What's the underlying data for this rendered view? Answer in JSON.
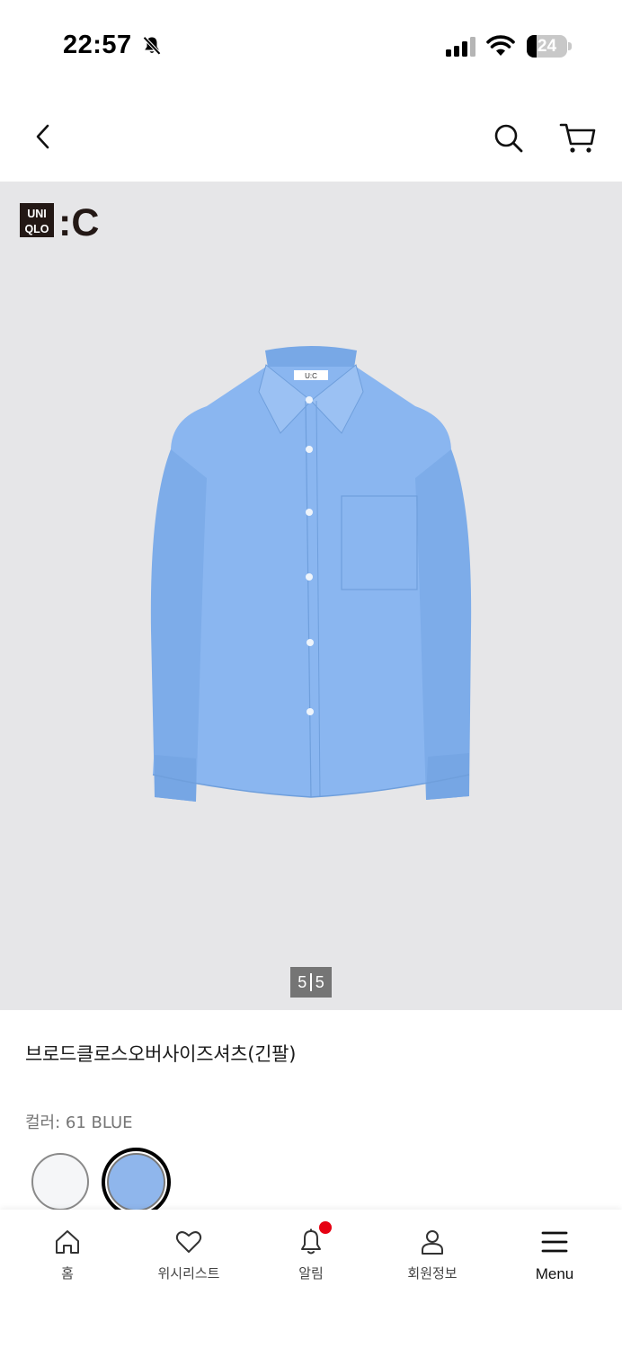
{
  "status_bar": {
    "time": "22:57",
    "battery": "24",
    "battery_level": 0.24,
    "icons": [
      "bell-slash-icon",
      "cellular-signal-icon",
      "wifi-icon",
      "battery-icon"
    ]
  },
  "top_nav": {
    "icons": [
      "chevron-left-icon",
      "search-icon",
      "cart-icon"
    ]
  },
  "gallery": {
    "brand_top": "UNI",
    "brand_bottom": "QLO",
    "brand_suffix": ":C",
    "collar_tag": "U:C",
    "page_current": "5",
    "page_total": "5"
  },
  "product": {
    "title": "브로드클로스오버사이즈셔츠(긴팔)",
    "color_label": "컬러: 61 BLUE",
    "swatches": [
      {
        "name": "white",
        "color": "#f5f6f8",
        "selected": false
      },
      {
        "name": "blue",
        "color": "#8fb6ec",
        "selected": true
      }
    ]
  },
  "tab_bar": {
    "tabs": [
      {
        "label": "홈",
        "icon": "home-icon"
      },
      {
        "label": "위시리스트",
        "icon": "heart-icon"
      },
      {
        "label": "알림",
        "icon": "bell-icon",
        "badge": true
      },
      {
        "label": "회원정보",
        "icon": "user-icon"
      },
      {
        "label": "Menu",
        "icon": "hamburger-icon"
      }
    ],
    "badge_color": "#e60012"
  }
}
